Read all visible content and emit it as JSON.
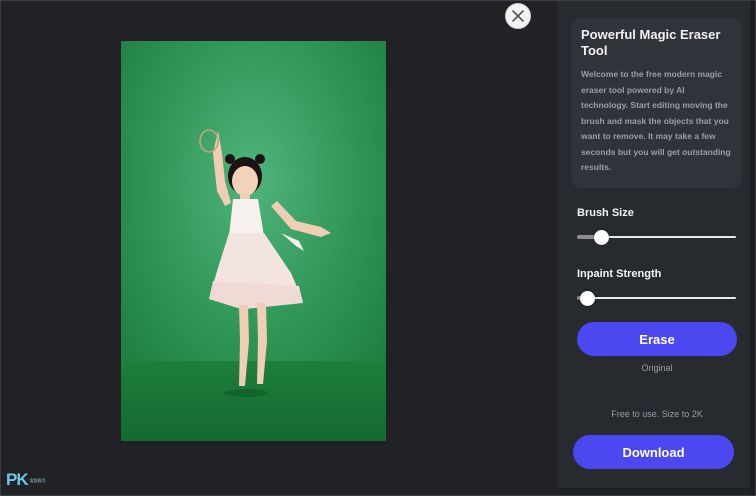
{
  "panel": {
    "title": "Powerful Magic Eraser Tool",
    "description": "Welcome to the free modern magic eraser tool powered by AI technology. Start editing moving the brush and mask the objects that you want to remove. It may take a few seconds but you will get outstanding results."
  },
  "controls": {
    "brush_size_label": "Brush Size",
    "brush_size_value": 0.12,
    "inpaint_strength_label": "Inpaint Strength",
    "inpaint_strength_value": 0.02,
    "erase_label": "Erase",
    "original_label": "Original",
    "free_note": "Free to use. Size to 2K",
    "download_label": "Download"
  },
  "icons": {
    "close": "close-icon"
  },
  "watermark": {
    "main": "PK",
    "sub": "電腦應用"
  },
  "colors": {
    "accent": "#4b48f2",
    "background": "#1f2124",
    "sidebar": "#272a2f",
    "card": "#30333a",
    "green_screen": "#2e9a55"
  }
}
